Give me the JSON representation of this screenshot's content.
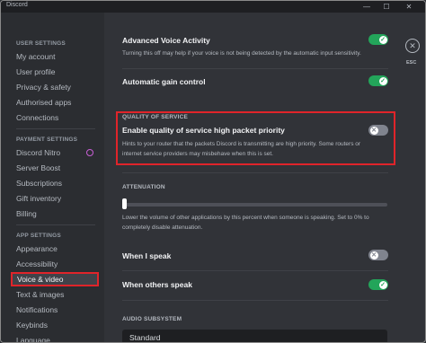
{
  "window": {
    "title": "Discord",
    "minimize": "—",
    "maximize": "☐",
    "close": "✕"
  },
  "sidebar": {
    "user_settings_header": "USER SETTINGS",
    "user_items": [
      "My account",
      "User profile",
      "Privacy & safety",
      "Authorised apps",
      "Connections"
    ],
    "payment_header": "PAYMENT SETTINGS",
    "payment_items": [
      "Discord Nitro",
      "Server Boost",
      "Subscriptions",
      "Gift inventory",
      "Billing"
    ],
    "app_header": "APP SETTINGS",
    "app_items": [
      "Appearance",
      "Accessibility",
      "Voice & video",
      "Text & images",
      "Notifications",
      "Keybinds",
      "Language"
    ],
    "active_item": "Voice & video"
  },
  "main": {
    "advanced_voice_activity": {
      "label": "Advanced Voice Activity",
      "desc": "Turning this off may help if your voice is not being detected by the automatic input sensitivity.",
      "on": true
    },
    "automatic_gain_control": {
      "label": "Automatic gain control",
      "on": true
    },
    "qos": {
      "header": "QUALITY OF SERVICE",
      "label": "Enable quality of service high packet priority",
      "desc_line1": "Hints to your router that the packets Discord is transmitting are high priority. Some routers or",
      "desc_line2": "internet service providers may misbehave when this is set.",
      "on": false
    },
    "attenuation": {
      "header": "ATTENUATION",
      "value_percent": 0,
      "desc_line1": "Lower the volume of other applications by this percent when someone is speaking. Set to 0% to",
      "desc_line2": "completely disable attenuation."
    },
    "when_i_speak": {
      "label": "When I speak",
      "on": false
    },
    "when_others_speak": {
      "label": "When others speak",
      "on": true
    },
    "audio_subsystem": {
      "header": "AUDIO SUBSYSTEM",
      "value": "Standard"
    },
    "close_label": "ESC",
    "close_glyph": "✕",
    "toggle_on_glyph": "✓",
    "toggle_off_glyph": "✕"
  },
  "colors": {
    "accent_green": "#23a55a",
    "highlight_red": "#e0242a",
    "background": "#313338",
    "sidebar": "#2b2d31"
  }
}
